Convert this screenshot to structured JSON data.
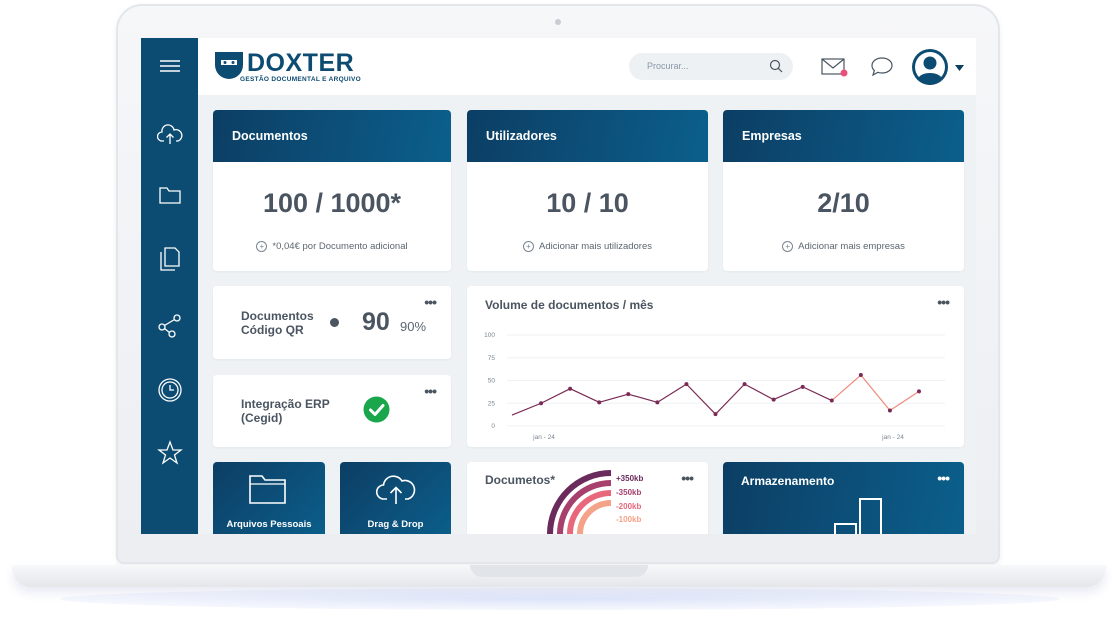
{
  "app": {
    "name": "DOXTER",
    "tagline": "GESTÃO DOCUMENTAL E ARQUIVO"
  },
  "search": {
    "placeholder": "Procurar..."
  },
  "sidebar": {
    "items": [
      {
        "icon": "menu-icon"
      },
      {
        "icon": "cloud-upload-icon"
      },
      {
        "icon": "folder-icon"
      },
      {
        "icon": "documents-icon"
      },
      {
        "icon": "workflow-icon"
      },
      {
        "icon": "clock-icon"
      },
      {
        "icon": "star-icon"
      }
    ]
  },
  "cards": {
    "documentos": {
      "title": "Documentos",
      "value": "100 / 1000*",
      "note": "*0,04€ por Documento adicional"
    },
    "utilizadores": {
      "title": "Utilizadores",
      "value": "10 / 10",
      "note": "Adicionar mais utilizadores"
    },
    "empresas": {
      "title": "Empresas",
      "value": "2/10",
      "note": "Adicionar mais empresas"
    }
  },
  "qr": {
    "label_line1": "Documentos",
    "label_line2": "Código QR",
    "value": "90",
    "percent": "90%"
  },
  "erp": {
    "label_line1": "Integração ERP",
    "label_line2": "(Cegid)",
    "status": "ok"
  },
  "menu_dots": "•••",
  "tiles": {
    "pessoais": "Arquivos Pessoais",
    "drag": "Drag & Drop"
  },
  "docs_card": {
    "title": "Documetos*",
    "legend": [
      "+350kb",
      "-350kb",
      "-200kb",
      "-100kb"
    ]
  },
  "storage_card": {
    "title": "Armazenamento"
  },
  "chart_data": {
    "type": "line",
    "title": "Volume de documentos / mês",
    "y_ticks": [
      "100",
      "75",
      "50",
      "25",
      "0"
    ],
    "ylim": [
      0,
      100
    ],
    "x_tick_labels": [
      "jan - 24",
      "jan - 24"
    ],
    "x": [
      1,
      2,
      3,
      4,
      5,
      6,
      7,
      8,
      9,
      10,
      11,
      12,
      13,
      14,
      15,
      16
    ],
    "values": [
      12,
      25,
      41,
      26,
      35,
      26,
      46,
      13,
      46,
      29,
      43,
      28,
      56,
      17,
      38
    ],
    "grid": true,
    "colors": {
      "line": "#7a2a55",
      "highlight": "#f08a7c"
    }
  },
  "colors": {
    "brand": "#0c4b72",
    "ok": "#1aa64a",
    "legend": [
      "#6b2a5c",
      "#a8406e",
      "#e8677a",
      "#f5a28a"
    ]
  }
}
